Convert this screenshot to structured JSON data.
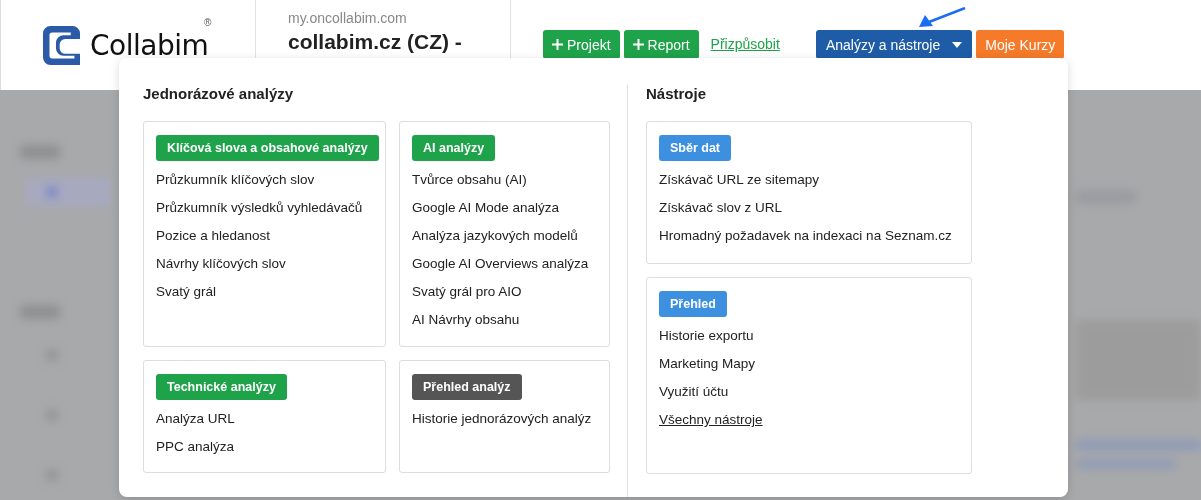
{
  "header": {
    "logo": {
      "name": "Collabim",
      "mark": "®"
    },
    "site": {
      "url": "my.oncollabim.com",
      "title": "collabim.cz (CZ) -"
    },
    "actions": [
      {
        "label": "Projekt",
        "kind": "add",
        "color": "#1ea34a"
      },
      {
        "label": "Report",
        "kind": "add",
        "color": "#1ea34a"
      },
      {
        "label": "Přizpůsobit",
        "kind": "link",
        "color": "#1ea34a"
      },
      {
        "label": "Analýzy a nástroje",
        "kind": "dropdown",
        "color": "#1f5ca8",
        "expanded": true
      },
      {
        "label": "Moje Kurzy",
        "kind": "plain",
        "color": "#f57a2a"
      }
    ]
  },
  "menu": {
    "columns": [
      {
        "heading": "Jednorázové analýzy",
        "cards": [
          {
            "badge": "Klíčová slova a obsahové analýzy",
            "color": "#1ea34a",
            "items": [
              {
                "label": "Průzkumník klíčových slov",
                "kind": "item"
              },
              {
                "label": "Průzkumník výsledků vyhledávačů",
                "kind": "item"
              },
              {
                "label": "Pozice a hledanost",
                "kind": "item"
              },
              {
                "label": "Návrhy klíčových slov",
                "kind": "item"
              },
              {
                "label": "Svatý grál",
                "kind": "item"
              }
            ]
          },
          {
            "badge": "AI analýzy",
            "color": "#1ea34a",
            "items": [
              {
                "label": "Tvůrce obsahu (AI)",
                "kind": "item"
              },
              {
                "label": "Google AI Mode analýza",
                "kind": "item"
              },
              {
                "label": "Analýza jazykových modelů",
                "kind": "item"
              },
              {
                "label": "Google AI Overviews analýza",
                "kind": "item"
              },
              {
                "label": "Svatý grál pro AIO",
                "kind": "item"
              },
              {
                "label": "AI Návrhy obsahu",
                "kind": "item"
              }
            ]
          },
          {
            "badge": "Technické analýzy",
            "color": "#1ea34a",
            "items": [
              {
                "label": "Analýza URL",
                "kind": "item"
              },
              {
                "label": "PPC analýza",
                "kind": "item"
              }
            ]
          },
          {
            "badge": "Přehled analýz",
            "color": "#555555",
            "items": [
              {
                "label": "Historie jednorázových analýz",
                "kind": "item"
              }
            ]
          }
        ]
      },
      {
        "heading": "Nástroje",
        "cards": [
          {
            "badge": "Sběr dat",
            "color": "#3d8fe0",
            "items": [
              {
                "label": "Získávač URL ze sitemapy",
                "kind": "item"
              },
              {
                "label": "Získávač slov z URL",
                "kind": "item"
              },
              {
                "label": "Hromadný požadavek na indexaci na Seznam.cz",
                "kind": "item"
              }
            ]
          },
          {
            "badge": "Přehled",
            "color": "#3d8fe0",
            "items": [
              {
                "label": "Historie exportu",
                "kind": "item"
              },
              {
                "label": "Marketing Mapy",
                "kind": "item"
              },
              {
                "label": "Využití účtu",
                "kind": "item"
              },
              {
                "label": "Všechny nástroje",
                "kind": "link"
              }
            ]
          }
        ]
      }
    ]
  }
}
